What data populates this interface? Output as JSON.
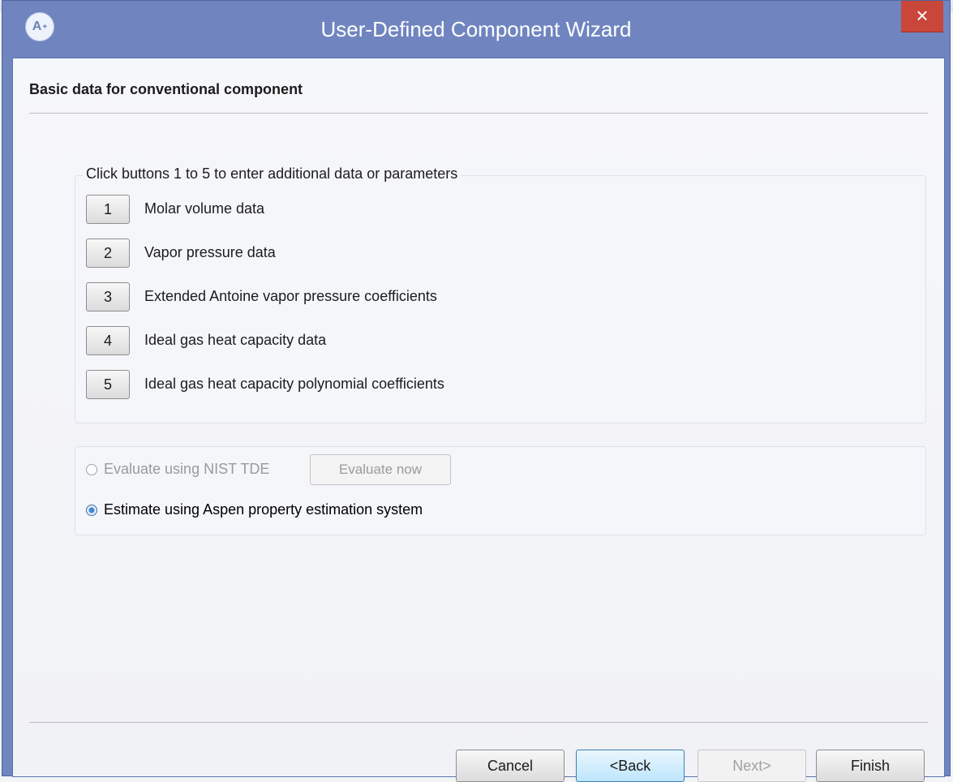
{
  "window": {
    "title": "User-Defined Component Wizard",
    "app_icon": "A",
    "app_icon_sup": "+",
    "close_glyph": "×"
  },
  "page": {
    "heading": "Basic data for conventional component"
  },
  "data_group": {
    "legend": "Click buttons 1 to 5 to enter additional data or parameters",
    "items": [
      {
        "number": "1",
        "label": "Molar volume data"
      },
      {
        "number": "2",
        "label": "Vapor pressure data"
      },
      {
        "number": "3",
        "label": "Extended Antoine vapor pressure coefficients"
      },
      {
        "number": "4",
        "label": "Ideal gas heat capacity data"
      },
      {
        "number": "5",
        "label": "Ideal gas heat capacity polynomial coefficients"
      }
    ]
  },
  "estimation": {
    "options": [
      {
        "label": "Evaluate using NIST TDE",
        "selected": false,
        "enabled": false
      },
      {
        "label": "Estimate using Aspen property estimation system",
        "selected": true,
        "enabled": true
      }
    ],
    "evaluate_button": "Evaluate now"
  },
  "footer": {
    "cancel": "Cancel",
    "back": "<Back",
    "next": "Next>",
    "finish": "Finish"
  },
  "colors": {
    "titlebar": "#7085c0",
    "close": "#c8473a",
    "focus": "#3c7fb1"
  }
}
